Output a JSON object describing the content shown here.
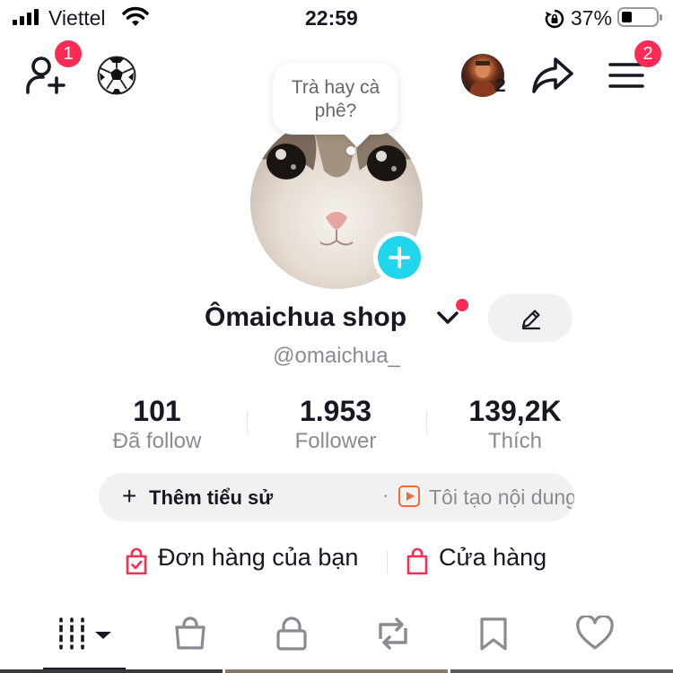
{
  "status_bar": {
    "carrier": "Viettel",
    "time": "22:59",
    "battery": "37%"
  },
  "top_bar": {
    "add_friend_badge": "1",
    "avatar_count": "2",
    "menu_badge": "2"
  },
  "profile": {
    "bubble_text": "Trà hay cà phê?",
    "name": "Ômaichua shop",
    "handle": "@omaichua_"
  },
  "stats": [
    {
      "value": "101",
      "label": "Đã follow"
    },
    {
      "value": "1.953",
      "label": "Follower"
    },
    {
      "value": "139,2K",
      "label": "Thích"
    }
  ],
  "bio": {
    "add_label": "Thêm tiểu sử",
    "separator": "·",
    "description": "Tôi tạo nội dung về..."
  },
  "shop": {
    "orders_label": "Đơn hàng của bạn",
    "store_label": "Cửa hàng"
  },
  "tabs": [
    "videos-grid",
    "shop-bag",
    "private-lock",
    "reposts",
    "saved-bookmark",
    "liked-heart"
  ],
  "colors": {
    "accent_red": "#fe2c55",
    "accent_cyan": "#20d5ec",
    "text_primary": "#161823",
    "text_secondary": "#8a8b91",
    "pill_bg": "#f1f1f2"
  }
}
